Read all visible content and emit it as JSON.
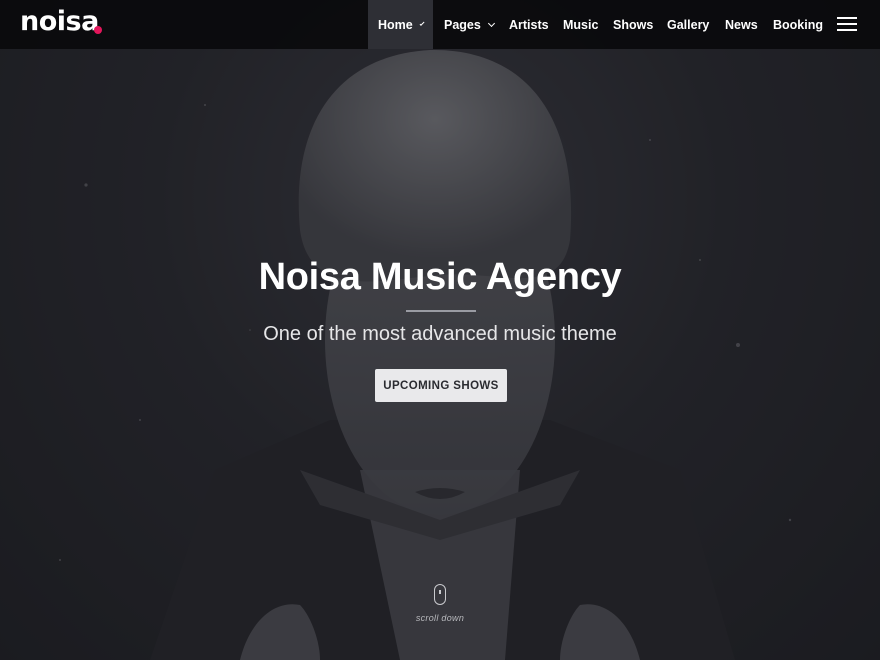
{
  "brand": {
    "logo_text": "noisa",
    "accent_color": "#e3165b"
  },
  "nav": {
    "items": [
      {
        "label": "Home",
        "has_dropdown": true,
        "active": true
      },
      {
        "label": "Pages",
        "has_dropdown": true,
        "active": false
      },
      {
        "label": "Artists",
        "has_dropdown": false,
        "active": false
      },
      {
        "label": "Music",
        "has_dropdown": false,
        "active": false
      },
      {
        "label": "Shows",
        "has_dropdown": false,
        "active": false
      },
      {
        "label": "Gallery",
        "has_dropdown": false,
        "active": false
      },
      {
        "label": "News",
        "has_dropdown": false,
        "active": false
      },
      {
        "label": "Booking",
        "has_dropdown": false,
        "active": false
      }
    ],
    "menu_icon": "hamburger-menu-icon"
  },
  "hero": {
    "title": "Noisa Music Agency",
    "subtitle": "One of the most advanced music theme",
    "cta_label": "UPCOMING SHOWS",
    "scroll_label": "scroll down",
    "scroll_icon": "mouse-scroll-icon"
  }
}
